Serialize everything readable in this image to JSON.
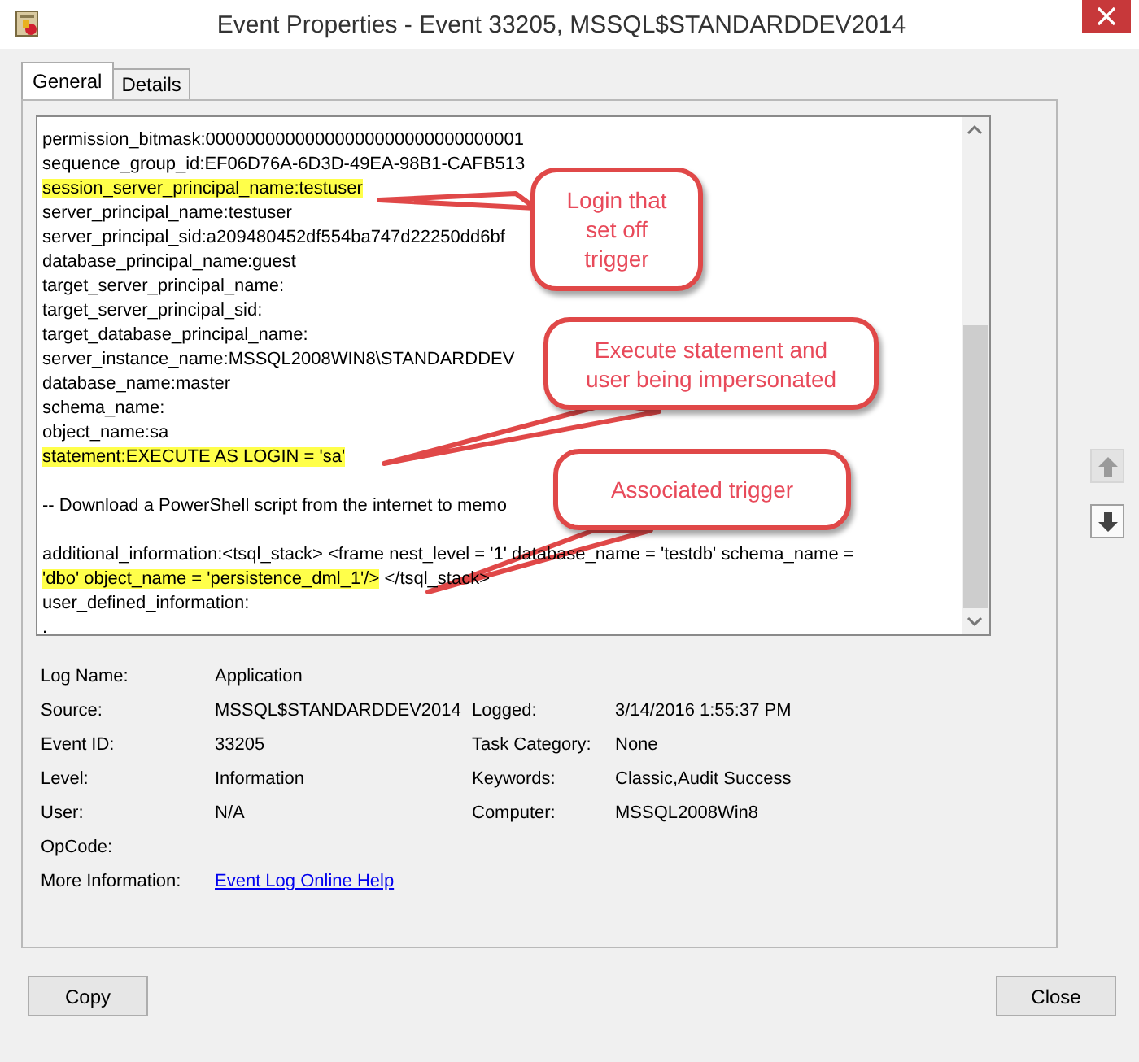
{
  "window": {
    "title": "Event Properties - Event 33205, MSSQL$STANDARDDEV2014"
  },
  "tabs": [
    {
      "label": "General",
      "selected": true
    },
    {
      "label": "Details",
      "selected": false
    }
  ],
  "event_text": [
    {
      "parts": [
        {
          "text": "permission_bitmask:00000000000000000000000000000001",
          "highlighted": false
        }
      ]
    },
    {
      "parts": [
        {
          "text": "sequence_group_id:EF06D76A-6D3D-49EA-98B1-CAFB513",
          "highlighted": false
        }
      ]
    },
    {
      "parts": [
        {
          "text": "session_server_principal_name:testuser",
          "highlighted": true
        }
      ]
    },
    {
      "parts": [
        {
          "text": "server_principal_name:testuser",
          "highlighted": false
        }
      ]
    },
    {
      "parts": [
        {
          "text": "server_principal_sid:a209480452df554ba747d22250dd6bf",
          "highlighted": false
        }
      ]
    },
    {
      "parts": [
        {
          "text": "database_principal_name:guest",
          "highlighted": false
        }
      ]
    },
    {
      "parts": [
        {
          "text": "target_server_principal_name:",
          "highlighted": false
        }
      ]
    },
    {
      "parts": [
        {
          "text": "target_server_principal_sid:",
          "highlighted": false
        }
      ]
    },
    {
      "parts": [
        {
          "text": "target_database_principal_name:",
          "highlighted": false
        }
      ]
    },
    {
      "parts": [
        {
          "text": "server_instance_name:MSSQL2008WIN8\\STANDARDDEV",
          "highlighted": false
        }
      ]
    },
    {
      "parts": [
        {
          "text": "database_name:master",
          "highlighted": false
        }
      ]
    },
    {
      "parts": [
        {
          "text": "schema_name:",
          "highlighted": false
        }
      ]
    },
    {
      "parts": [
        {
          "text": "object_name:sa",
          "highlighted": false
        }
      ]
    },
    {
      "parts": [
        {
          "text": "statement:EXECUTE AS LOGIN = 'sa'",
          "highlighted": true
        }
      ]
    },
    {
      "space_before": true,
      "parts": [
        {
          "text": "-- Download a PowerShell script from the internet to memo",
          "highlighted": false
        }
      ]
    },
    {
      "space_before": true,
      "parts": [
        {
          "text": "additional_information:<tsql_stack> <frame nest_level = '1' database_name = 'testdb' schema_name =",
          "highlighted": false
        }
      ]
    },
    {
      "parts": [
        {
          "text": "'dbo' object_name = 'persistence_dml_1'/>",
          "highlighted": true
        },
        {
          "text": " </tsql_stack>",
          "highlighted": false
        }
      ]
    },
    {
      "parts": [
        {
          "text": "user_defined_information:",
          "highlighted": false
        }
      ]
    },
    {
      "parts": [
        {
          "text": ".",
          "highlighted": false
        }
      ]
    }
  ],
  "callouts": [
    {
      "text": "Login that set off trigger"
    },
    {
      "text": "Execute statement and user being impersonated"
    },
    {
      "text": "Associated trigger"
    }
  ],
  "nav_buttons": [
    {
      "kind": "up",
      "disabled": true
    },
    {
      "kind": "down",
      "disabled": false
    }
  ],
  "details": [
    {
      "label": "Log Name:",
      "value": "Application"
    },
    {
      "label": "Source:",
      "value": "MSSQL$STANDARDDEV2014",
      "label_2": "Logged:",
      "value_2": "3/14/2016 1:55:37 PM"
    },
    {
      "label": "Event ID:",
      "value": "33205",
      "label_2": "Task Category:",
      "value_2": "None"
    },
    {
      "label": "Level:",
      "value": "Information",
      "label_2": "Keywords:",
      "value_2": "Classic,Audit Success"
    },
    {
      "label": "User:",
      "value": "N/A",
      "label_2": "Computer:",
      "value_2": "MSSQL2008Win8"
    },
    {
      "label": "OpCode:"
    },
    {
      "label": "More Information:",
      "link": "Event Log Online Help"
    }
  ],
  "buttons": [
    "Copy",
    "Close"
  ]
}
